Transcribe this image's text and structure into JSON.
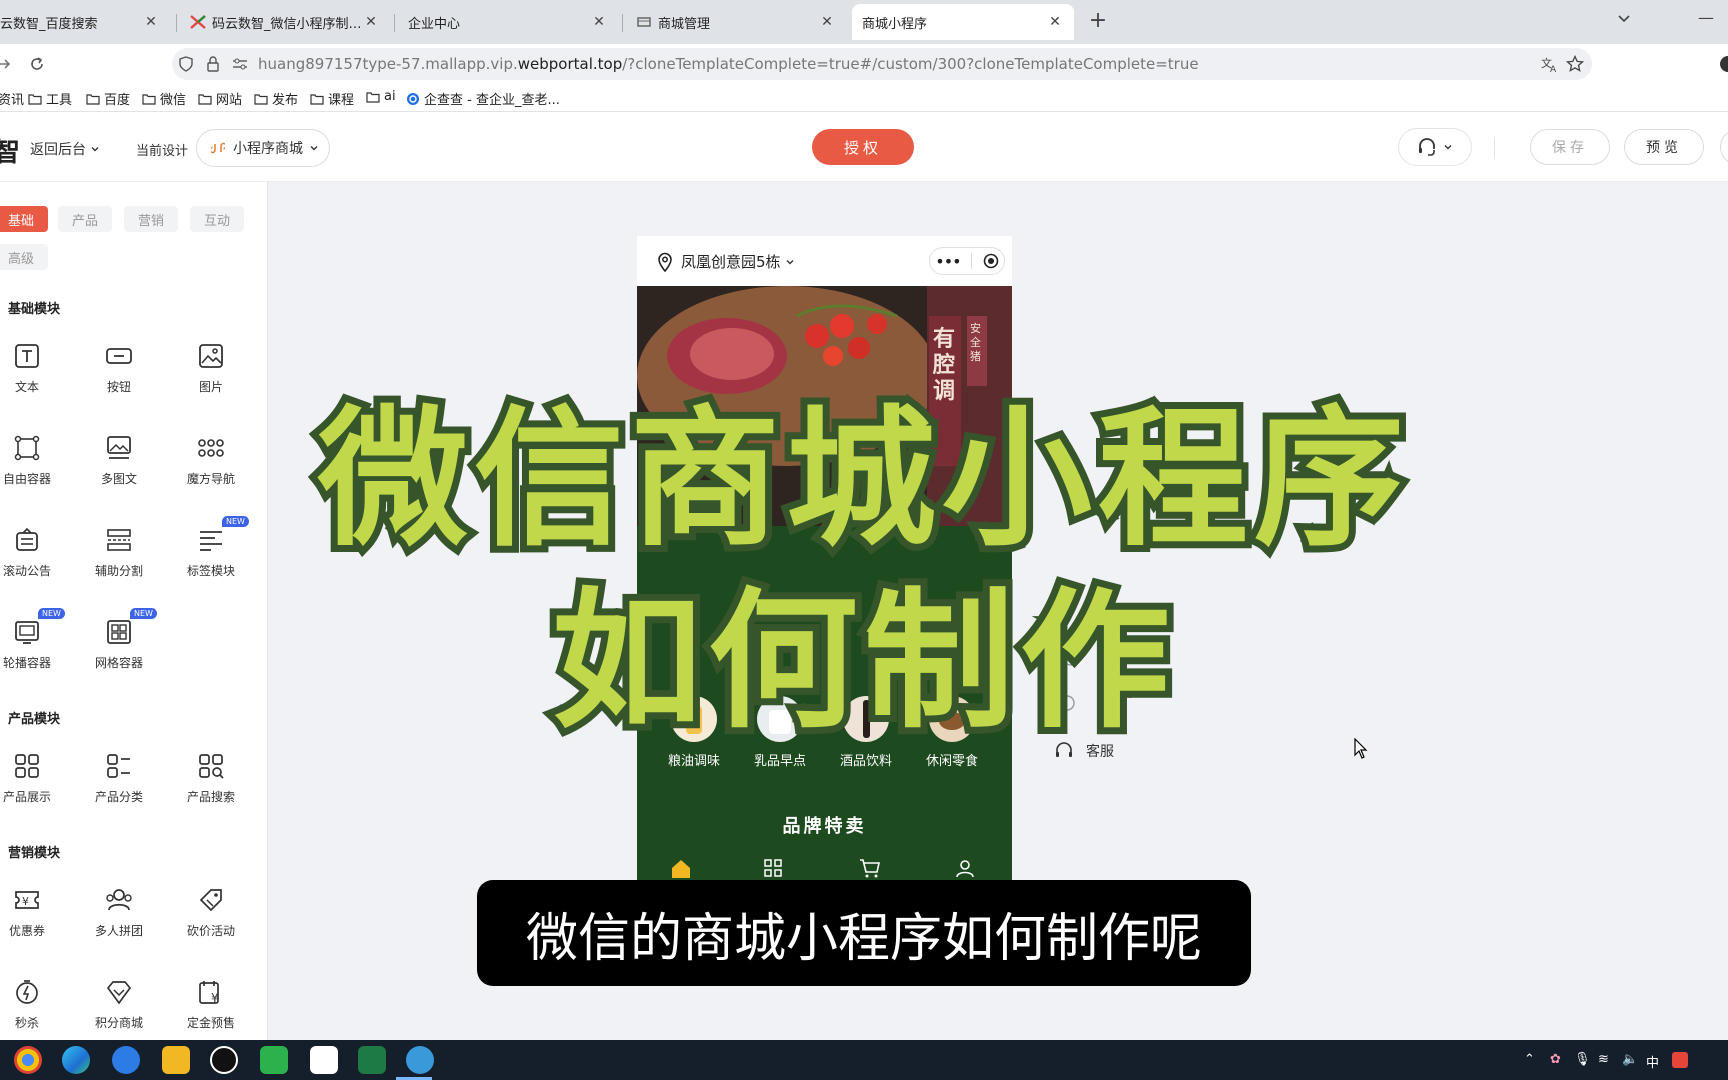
{
  "browser": {
    "tabs": [
      {
        "title": "云数智_百度搜索",
        "active": false
      },
      {
        "title": "码云数智_微信小程序制作平台_",
        "active": false
      },
      {
        "title": "企业中心",
        "active": false
      },
      {
        "title": "商城管理",
        "active": false
      },
      {
        "title": "商城小程序",
        "active": true
      }
    ],
    "new_tab": "+",
    "url_prefix": "huang897157type-57.mallapp.vip.",
    "url_domain": "webportal.top",
    "url_rest": "/?cloneTemplateComplete=true#/custom/300?cloneTemplateComplete=true",
    "bookmarks": [
      "资讯",
      "工具",
      "百度",
      "微信",
      "网站",
      "发布",
      "课程",
      "ai",
      "企查查 - 查企业_查老..."
    ]
  },
  "header": {
    "brand": "智",
    "back": "返回后台",
    "current_design": "当前设计",
    "design_select": "小程序商城",
    "auth": "授权",
    "save": "保存",
    "preview": "预览"
  },
  "sidebar": {
    "categories": [
      "基础",
      "产品",
      "营销",
      "互动",
      "高级"
    ],
    "sections": [
      {
        "title": "基础模块",
        "items": [
          {
            "label": "文本",
            "icon": "text-icon",
            "new": false
          },
          {
            "label": "按钮",
            "icon": "button-icon",
            "new": false
          },
          {
            "label": "图片",
            "icon": "image-icon",
            "new": false
          },
          {
            "label": "自由容器",
            "icon": "free-container-icon",
            "new": false
          },
          {
            "label": "多图文",
            "icon": "multi-image-icon",
            "new": false
          },
          {
            "label": "魔方导航",
            "icon": "cube-nav-icon",
            "new": false
          },
          {
            "label": "滚动公告",
            "icon": "notice-icon",
            "new": false
          },
          {
            "label": "辅助分割",
            "icon": "divider-icon",
            "new": false
          },
          {
            "label": "标签模块",
            "icon": "tag-module-icon",
            "new": true
          },
          {
            "label": "轮播容器",
            "icon": "carousel-icon",
            "new": true
          },
          {
            "label": "网格容器",
            "icon": "grid-container-icon",
            "new": true
          }
        ]
      },
      {
        "title": "产品模块",
        "items": [
          {
            "label": "产品展示",
            "icon": "product-display-icon",
            "new": false
          },
          {
            "label": "产品分类",
            "icon": "product-category-icon",
            "new": false
          },
          {
            "label": "产品搜索",
            "icon": "product-search-icon",
            "new": false
          }
        ]
      },
      {
        "title": "营销模块",
        "items": [
          {
            "label": "优惠券",
            "icon": "coupon-icon",
            "new": false
          },
          {
            "label": "多人拼团",
            "icon": "group-buy-icon",
            "new": false
          },
          {
            "label": "砍价活动",
            "icon": "bargain-icon",
            "new": false
          },
          {
            "label": "秒杀",
            "icon": "flash-sale-icon",
            "new": false
          },
          {
            "label": "积分商城",
            "icon": "points-mall-icon",
            "new": false
          },
          {
            "label": "定金预售",
            "icon": "presale-icon",
            "new": false
          }
        ]
      }
    ],
    "new_badge": "NEW"
  },
  "phone": {
    "location": "凤凰创意园5栋",
    "banner_text": "有腔调",
    "banner_side": "安全猪",
    "quick_nav": [
      "粮油调味",
      "乳品早点",
      "酒品饮料",
      "休闲零食"
    ],
    "brand_section": "品牌特卖"
  },
  "right_panel": {
    "kefu": "客服"
  },
  "overlay": {
    "title_line1": "微信商城小程序",
    "title_line2": "如何制作",
    "subtitle": "微信的商城小程序如何制作呢"
  },
  "tray": {
    "ime": "中"
  },
  "colors": {
    "accent": "#e85a43",
    "phone_bg": "#1d4a1f",
    "overlay_fill": "#c0d84a",
    "overlay_stroke": "#37552a"
  }
}
